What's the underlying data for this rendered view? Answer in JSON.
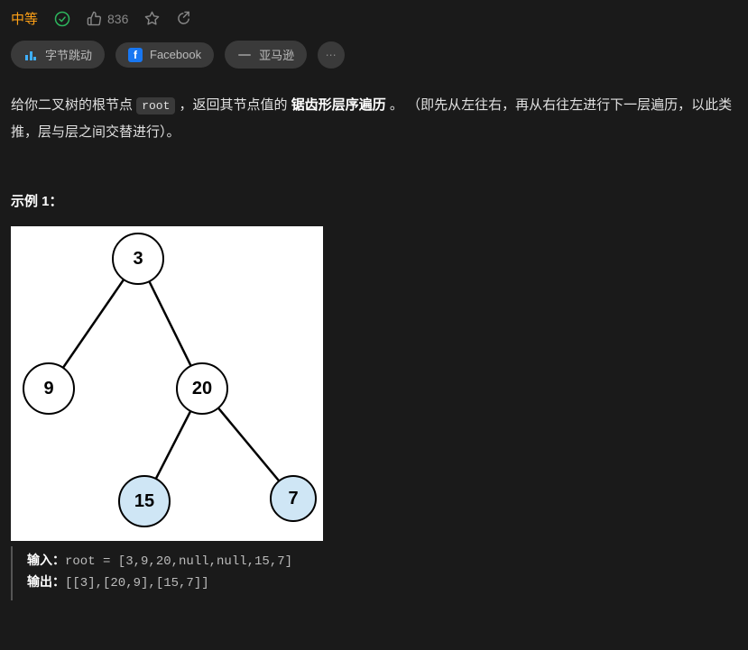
{
  "header": {
    "difficulty": "中等",
    "likes": "836"
  },
  "tags": {
    "bytedance": "字节跳动",
    "facebook": "Facebook",
    "amazon": "亚马逊",
    "more": "⋯"
  },
  "desc": {
    "p1": "给你二叉树的根节点 ",
    "code1": "root",
    "p2": " ，返回其节点值的 ",
    "bold": "锯齿形层序遍历",
    "p3": " 。 （即先从左往右，再从右往左进行下一层遍历，以此类推，层与层之间交替进行）。"
  },
  "example": {
    "heading": "示例 1：",
    "tree": {
      "n1": "3",
      "n2": "9",
      "n3": "20",
      "n4": "15",
      "n5": "7"
    },
    "input_label": "输入：",
    "input_value": "root = [3,9,20,null,null,15,7]",
    "output_label": "输出：",
    "output_value": "[[3],[20,9],[15,7]]"
  }
}
